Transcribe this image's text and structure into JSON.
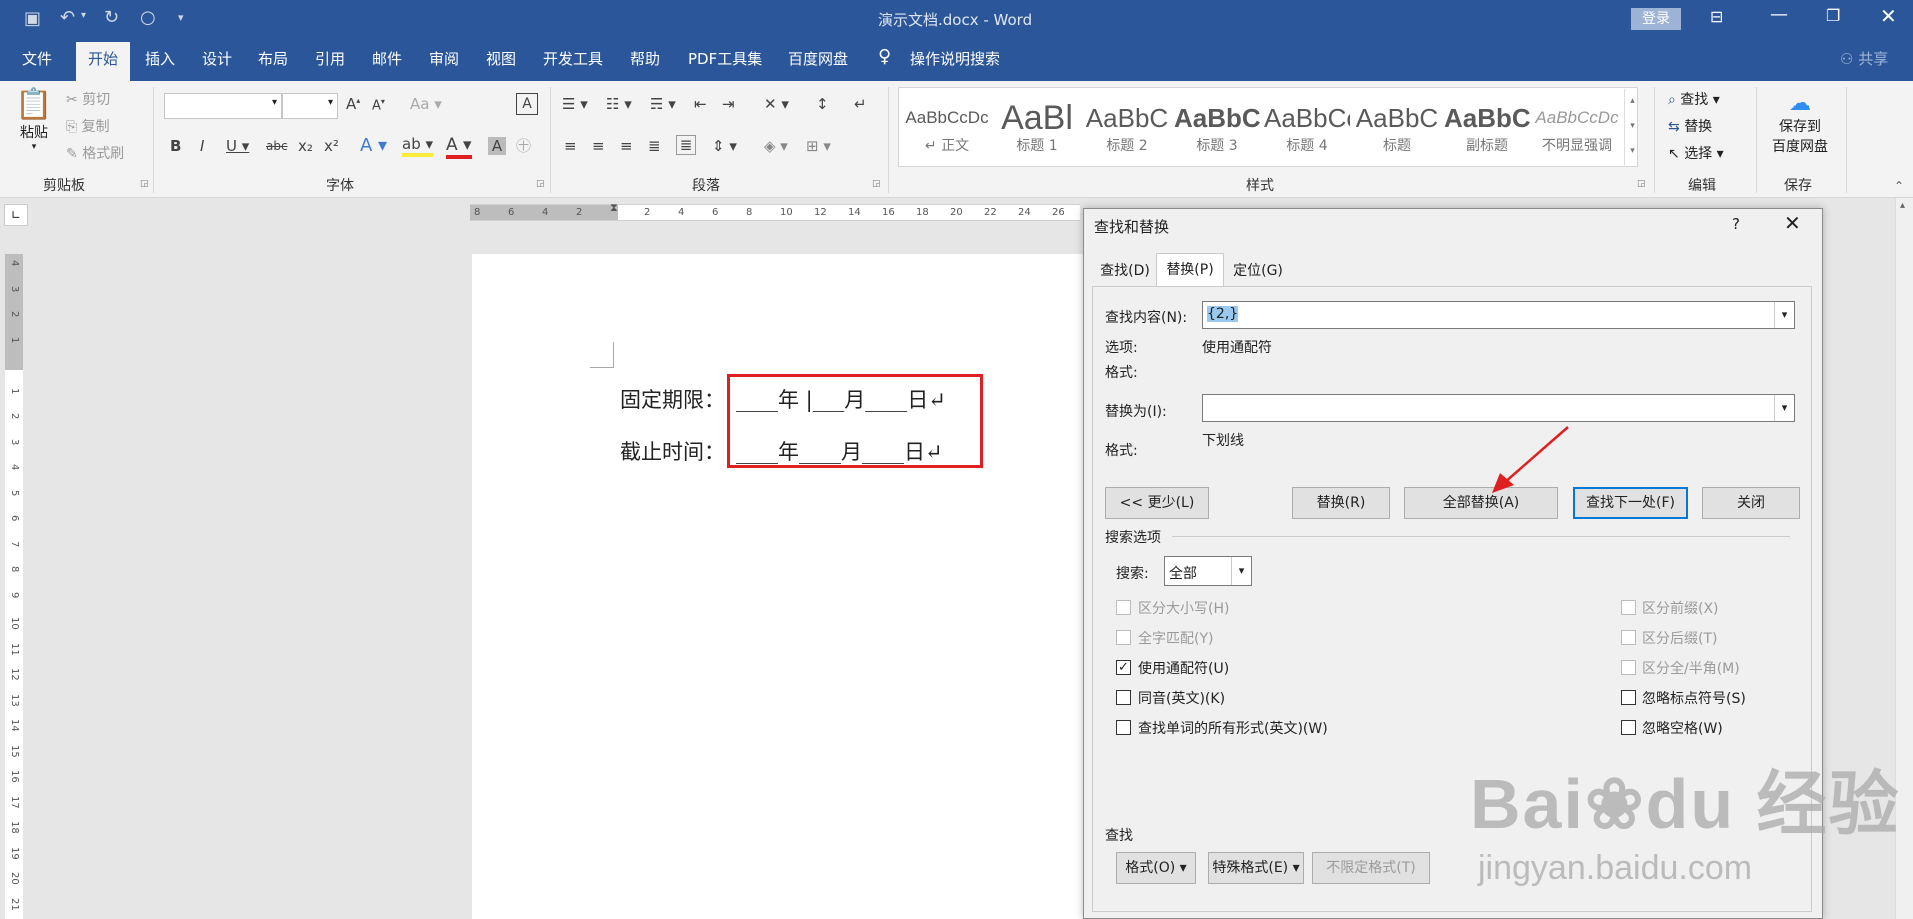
{
  "titlebar": {
    "document_title": "演示文档.docx - Word",
    "login": "登录",
    "share": "共享"
  },
  "tabs": [
    "文件",
    "开始",
    "插入",
    "设计",
    "布局",
    "引用",
    "邮件",
    "审阅",
    "视图",
    "开发工具",
    "帮助",
    "PDF工具集",
    "百度网盘",
    "操作说明搜索"
  ],
  "ribbon": {
    "clipboard": {
      "paste": "粘贴",
      "cut": "剪切",
      "copy": "复制",
      "format_painter": "格式刷",
      "group": "剪贴板"
    },
    "font": {
      "group": "字体"
    },
    "paragraph": {
      "group": "段落"
    },
    "styles": {
      "group": "样式",
      "items": [
        {
          "sample": "AaBbCcDc",
          "name": "↵ 正文"
        },
        {
          "sample": "AaBl",
          "name": "标题 1"
        },
        {
          "sample": "AaBbC",
          "name": "标题 2"
        },
        {
          "sample": "AaBbC",
          "name": "标题 3"
        },
        {
          "sample": "AaBbCc",
          "name": "标题 4"
        },
        {
          "sample": "AaBbC",
          "name": "标题"
        },
        {
          "sample": "AaBbC",
          "name": "副标题"
        },
        {
          "sample": "AaBbCcDc",
          "name": "不明显强调"
        }
      ]
    },
    "editing": {
      "find": "查找",
      "replace": "替换",
      "select": "选择",
      "group": "编辑"
    },
    "save": {
      "label1": "保存到",
      "label2": "百度网盘",
      "group": "保存"
    }
  },
  "document": {
    "line1": {
      "label": "固定期限：",
      "content": "____年 |___月____日↵"
    },
    "line2": {
      "label": "截止时间：",
      "content": "____年____月____日↵"
    }
  },
  "dialog": {
    "title": "查找和替换",
    "help": "?",
    "tabs": [
      "查找(D)",
      "替换(P)",
      "定位(G)"
    ],
    "find_label": "查找内容(N):",
    "find_value": "{2,}",
    "options_label": "选项:",
    "options_value": "使用通配符",
    "format_label": "格式:",
    "replace_label": "替换为(I):",
    "replace_value": "",
    "replace_format_label": "格式:",
    "replace_format_value": "下划线",
    "buttons": {
      "less": "<< 更少(L)",
      "replace": "替换(R)",
      "replace_all": "全部替换(A)",
      "find_next": "查找下一处(F)",
      "close": "关闭"
    },
    "search_options_title": "搜索选项",
    "search_label": "搜索:",
    "search_value": "全部",
    "left_options": [
      {
        "label": "区分大小写(H)",
        "checked": false,
        "enabled": false
      },
      {
        "label": "全字匹配(Y)",
        "checked": false,
        "enabled": false
      },
      {
        "label": "使用通配符(U)",
        "checked": true,
        "enabled": true
      },
      {
        "label": "同音(英文)(K)",
        "checked": false,
        "enabled": true
      },
      {
        "label": "查找单词的所有形式(英文)(W)",
        "checked": false,
        "enabled": true
      }
    ],
    "right_options": [
      {
        "label": "区分前缀(X)",
        "checked": false,
        "enabled": false
      },
      {
        "label": "区分后缀(T)",
        "checked": false,
        "enabled": false
      },
      {
        "label": "区分全/半角(M)",
        "checked": false,
        "enabled": false
      },
      {
        "label": "忽略标点符号(S)",
        "checked": false,
        "enabled": true
      },
      {
        "label": "忽略空格(W)",
        "checked": false,
        "enabled": true
      }
    ],
    "find_section": "查找",
    "bottom_buttons": {
      "format": "格式(O) ▾",
      "special": "特殊格式(E) ▾",
      "no_format": "不限定格式(T)"
    }
  },
  "watermark": {
    "text": "jingyan.baidu.com"
  },
  "colors": {
    "word_blue": "#2b579a",
    "highlight": "#e02020"
  }
}
